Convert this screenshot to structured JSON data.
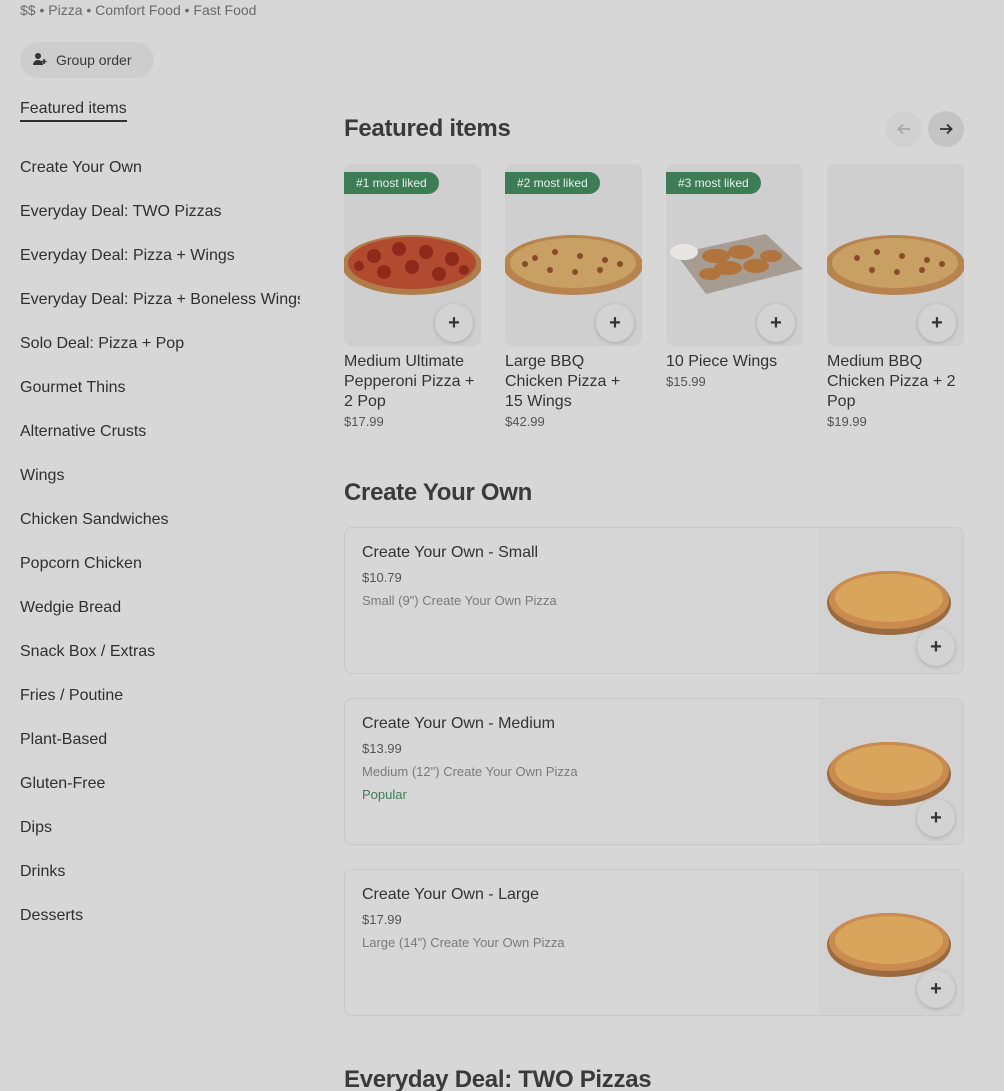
{
  "store_meta": "$$ • Pizza • Comfort Food • Fast Food",
  "group_order": {
    "label": "Group order",
    "icon": "person-add-icon"
  },
  "sidebar": {
    "items": [
      {
        "label": "Featured items"
      },
      {
        "label": "Create Your Own"
      },
      {
        "label": "Everyday Deal: TWO Pizzas"
      },
      {
        "label": "Everyday Deal: Pizza + Wings"
      },
      {
        "label": "Everyday Deal: Pizza + Boneless Wings"
      },
      {
        "label": "Solo Deal: Pizza + Pop"
      },
      {
        "label": "Gourmet Thins"
      },
      {
        "label": "Alternative Crusts"
      },
      {
        "label": "Wings"
      },
      {
        "label": "Chicken Sandwiches"
      },
      {
        "label": "Popcorn Chicken"
      },
      {
        "label": "Wedgie Bread"
      },
      {
        "label": "Snack Box / Extras"
      },
      {
        "label": "Fries / Poutine"
      },
      {
        "label": "Plant-Based"
      },
      {
        "label": "Gluten-Free"
      },
      {
        "label": "Dips"
      },
      {
        "label": "Drinks"
      },
      {
        "label": "Desserts"
      }
    ]
  },
  "featured": {
    "title": "Featured items",
    "items": [
      {
        "badge": "#1 most liked",
        "name": "Medium Ultimate Pepperoni Pizza + 2 Pop",
        "price": "$17.99",
        "image": "pepperoni-pizza"
      },
      {
        "badge": "#2 most liked",
        "name": "Large BBQ Chicken Pizza + 15 Wings",
        "price": "$42.99",
        "image": "bbq-chicken-pizza"
      },
      {
        "badge": "#3 most liked",
        "name": "10 Piece Wings",
        "price": "$15.99",
        "image": "chicken-wings"
      },
      {
        "badge": "",
        "name": "Medium BBQ Chicken Pizza + 2 Pop",
        "price": "$19.99",
        "image": "bbq-chicken-pizza"
      }
    ]
  },
  "create_your_own": {
    "title": "Create Your Own",
    "items": [
      {
        "name": "Create Your Own - Small",
        "price": "$10.79",
        "desc": "Small (9\") Create Your Own Pizza",
        "tag": ""
      },
      {
        "name": "Create Your Own - Medium",
        "price": "$13.99",
        "desc": "Medium (12\") Create Your Own Pizza",
        "tag": "Popular"
      },
      {
        "name": "Create Your Own - Large",
        "price": "$17.99",
        "desc": "Large (14\") Create Your Own Pizza",
        "tag": ""
      }
    ]
  },
  "next_section_title": "Everyday Deal: TWO Pizzas",
  "plus_symbol": "+",
  "colors": {
    "badge": "#3c7d56",
    "popular": "#3c7d56",
    "background": "#d7d7d7"
  }
}
